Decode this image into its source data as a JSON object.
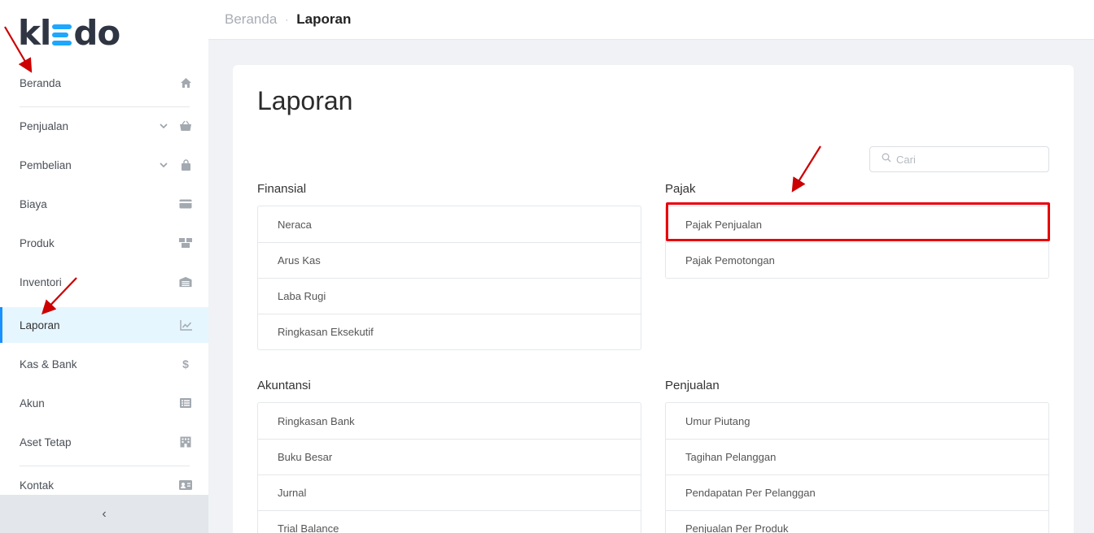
{
  "logo": {
    "prefix": "kl",
    "suffix": "do"
  },
  "sidebar": {
    "items": [
      {
        "label": "Beranda",
        "icon": "home-icon",
        "chevron": false
      },
      {
        "label": "Penjualan",
        "icon": "basket-icon",
        "chevron": true
      },
      {
        "label": "Pembelian",
        "icon": "bag-icon",
        "chevron": true
      },
      {
        "label": "Biaya",
        "icon": "credit-card-icon",
        "chevron": false
      },
      {
        "label": "Produk",
        "icon": "boxes-icon",
        "chevron": false
      },
      {
        "label": "Inventori",
        "icon": "warehouse-icon",
        "chevron": false
      },
      {
        "label": "Laporan",
        "icon": "chart-line-icon",
        "chevron": false,
        "active": true
      },
      {
        "label": "Kas & Bank",
        "icon": "dollar-icon",
        "chevron": false
      },
      {
        "label": "Akun",
        "icon": "list-icon",
        "chevron": false
      },
      {
        "label": "Aset Tetap",
        "icon": "building-icon",
        "chevron": false
      },
      {
        "label": "Kontak",
        "icon": "contact-card-icon",
        "chevron": false
      }
    ],
    "collapse_glyph": "‹"
  },
  "breadcrumb": {
    "home": "Beranda",
    "separator": "·",
    "current": "Laporan"
  },
  "page": {
    "title": "Laporan"
  },
  "search": {
    "placeholder": "Cari"
  },
  "sections": {
    "finansial": {
      "title": "Finansial",
      "items": [
        "Neraca",
        "Arus Kas",
        "Laba Rugi",
        "Ringkasan Eksekutif"
      ]
    },
    "pajak": {
      "title": "Pajak",
      "items": [
        "Pajak Penjualan",
        "Pajak Pemotongan"
      ]
    },
    "akuntansi": {
      "title": "Akuntansi",
      "items": [
        "Ringkasan Bank",
        "Buku Besar",
        "Jurnal",
        "Trial Balance"
      ]
    },
    "penjualan": {
      "title": "Penjualan",
      "items": [
        "Umur Piutang",
        "Tagihan Pelanggan",
        "Pendapatan Per Pelanggan",
        "Penjualan Per Produk"
      ]
    }
  },
  "colors": {
    "accent": "#1890ff",
    "active_bg": "#e6f6ff",
    "annotation_red": "#e8000b",
    "logo_blue": "#1ea7fd"
  }
}
